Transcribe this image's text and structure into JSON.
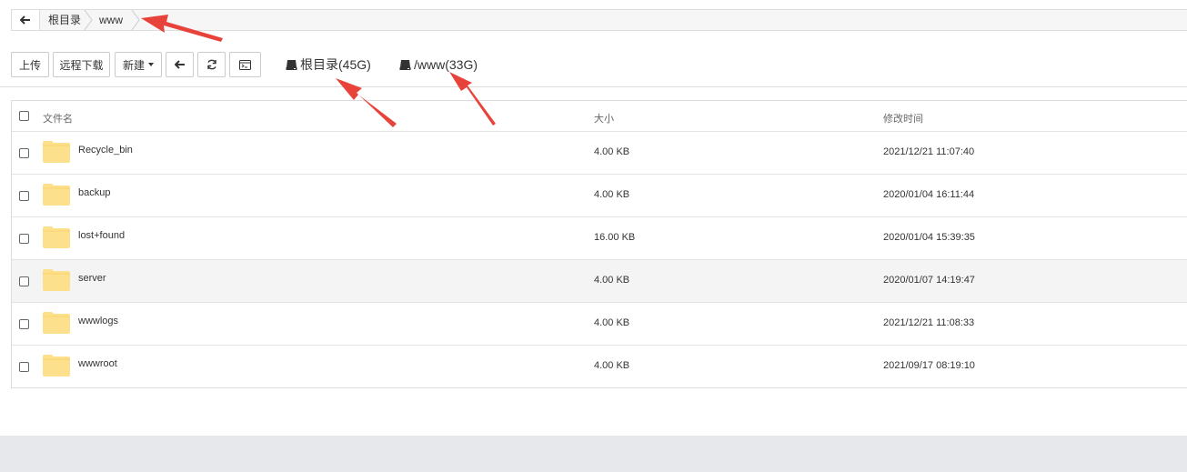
{
  "breadcrumb": {
    "items": [
      "根目录",
      "www"
    ]
  },
  "toolbar": {
    "upload": "上传",
    "remote_download": "远程下载",
    "new": "新建"
  },
  "disks": [
    {
      "label": "根目录(45G)"
    },
    {
      "label": "/www(33G)"
    }
  ],
  "table": {
    "headers": {
      "name": "文件名",
      "size": "大小",
      "modified": "修改时间"
    },
    "rows": [
      {
        "name": "Recycle_bin",
        "size": "4.00 KB",
        "modified": "2021/12/21 11:07:40"
      },
      {
        "name": "backup",
        "size": "4.00 KB",
        "modified": "2020/01/04 16:11:44"
      },
      {
        "name": "lost+found",
        "size": "16.00 KB",
        "modified": "2020/01/04 15:39:35"
      },
      {
        "name": "server",
        "size": "4.00 KB",
        "modified": "2020/01/07 14:19:47"
      },
      {
        "name": "wwwlogs",
        "size": "4.00 KB",
        "modified": "2021/12/21 11:08:33"
      },
      {
        "name": "wwwroot",
        "size": "4.00 KB",
        "modified": "2021/09/17 08:19:10"
      }
    ]
  },
  "colors": {
    "folder": "#fde08b",
    "arrow": "#e8433a"
  }
}
